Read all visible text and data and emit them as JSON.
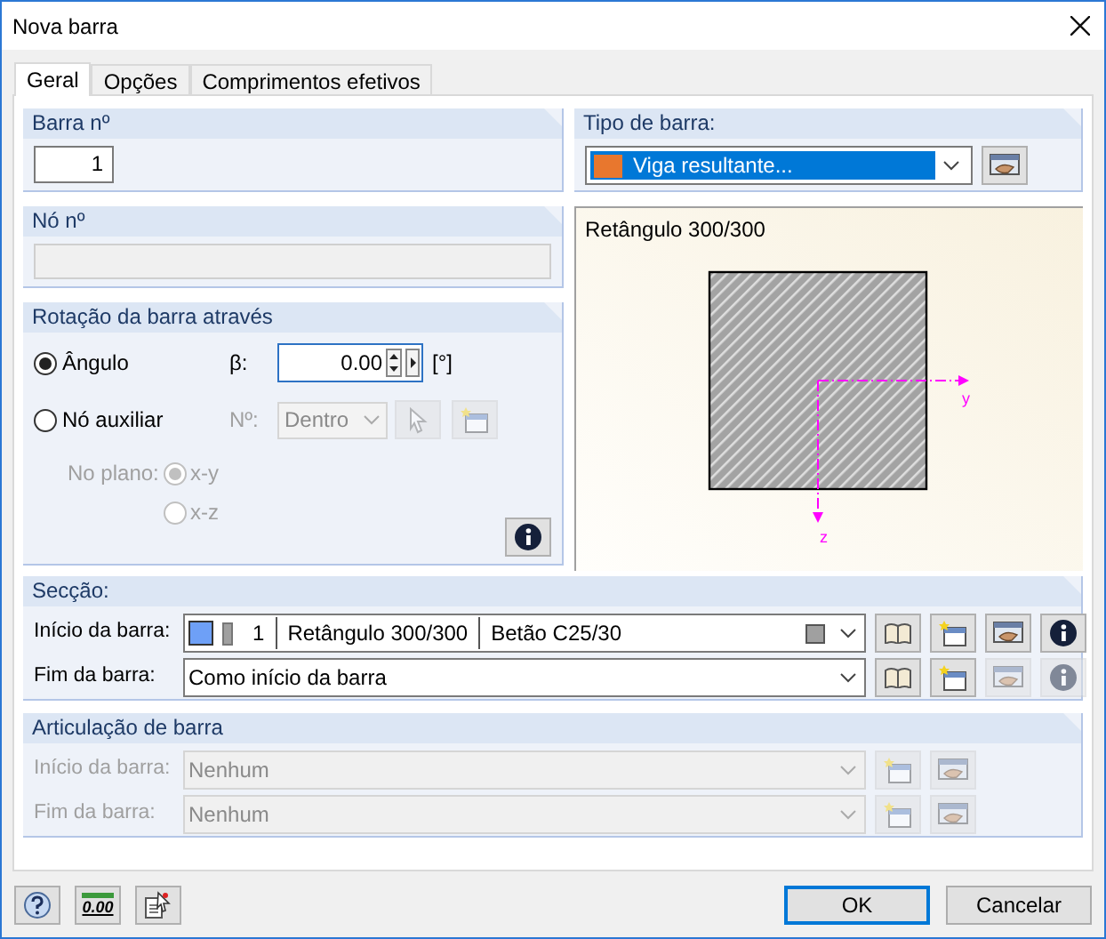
{
  "window": {
    "title": "Nova barra"
  },
  "tabs": [
    {
      "label": "Geral",
      "selected": true
    },
    {
      "label": "Opções",
      "selected": false
    },
    {
      "label": "Comprimentos efetivos",
      "selected": false
    }
  ],
  "member_no": {
    "label": "Barra nº",
    "value": "1"
  },
  "node_no": {
    "label": "Nó nº"
  },
  "member_type": {
    "label": "Tipo de barra:",
    "value": "Viga resultante...",
    "color": "#e8772e"
  },
  "preview": {
    "title": "Retângulo 300/300",
    "axis_y": "y",
    "axis_z": "z"
  },
  "rotation": {
    "label": "Rotação da barra através",
    "options": [
      {
        "label": "Ângulo",
        "selected": true
      },
      {
        "label": "Nó auxiliar",
        "selected": false
      }
    ],
    "beta_label": "β:",
    "beta_value": "0.00",
    "unit": "[°]",
    "node_label": "Nº:",
    "node_value": "Dentro",
    "aux_disabled": true,
    "plane_label": "No plano:",
    "planes": [
      {
        "label": "x-y",
        "selected": true
      },
      {
        "label": "x-z",
        "selected": false
      }
    ]
  },
  "section": {
    "label": "Secção:",
    "rows": [
      {
        "kind": "detail",
        "label": "Início da barra:",
        "color": "#6ea0f7",
        "number": "1",
        "name": "Retângulo 300/300",
        "material": "Betão C25/30",
        "edit_enabled": true
      },
      {
        "kind": "plain",
        "label": "Fim da barra:",
        "value": "Como início da barra",
        "edit_enabled": false
      }
    ]
  },
  "hinge": {
    "label": "Articulação de barra",
    "disabled": true,
    "rows": [
      {
        "label": "Início da barra:",
        "value": "Nenhum"
      },
      {
        "label": "Fim da barra:",
        "value": "Nenhum"
      }
    ]
  },
  "footer": {
    "units_text": "0.00",
    "buttons": [
      {
        "label": "OK",
        "default": true
      },
      {
        "label": "Cancelar",
        "default": false
      }
    ]
  }
}
